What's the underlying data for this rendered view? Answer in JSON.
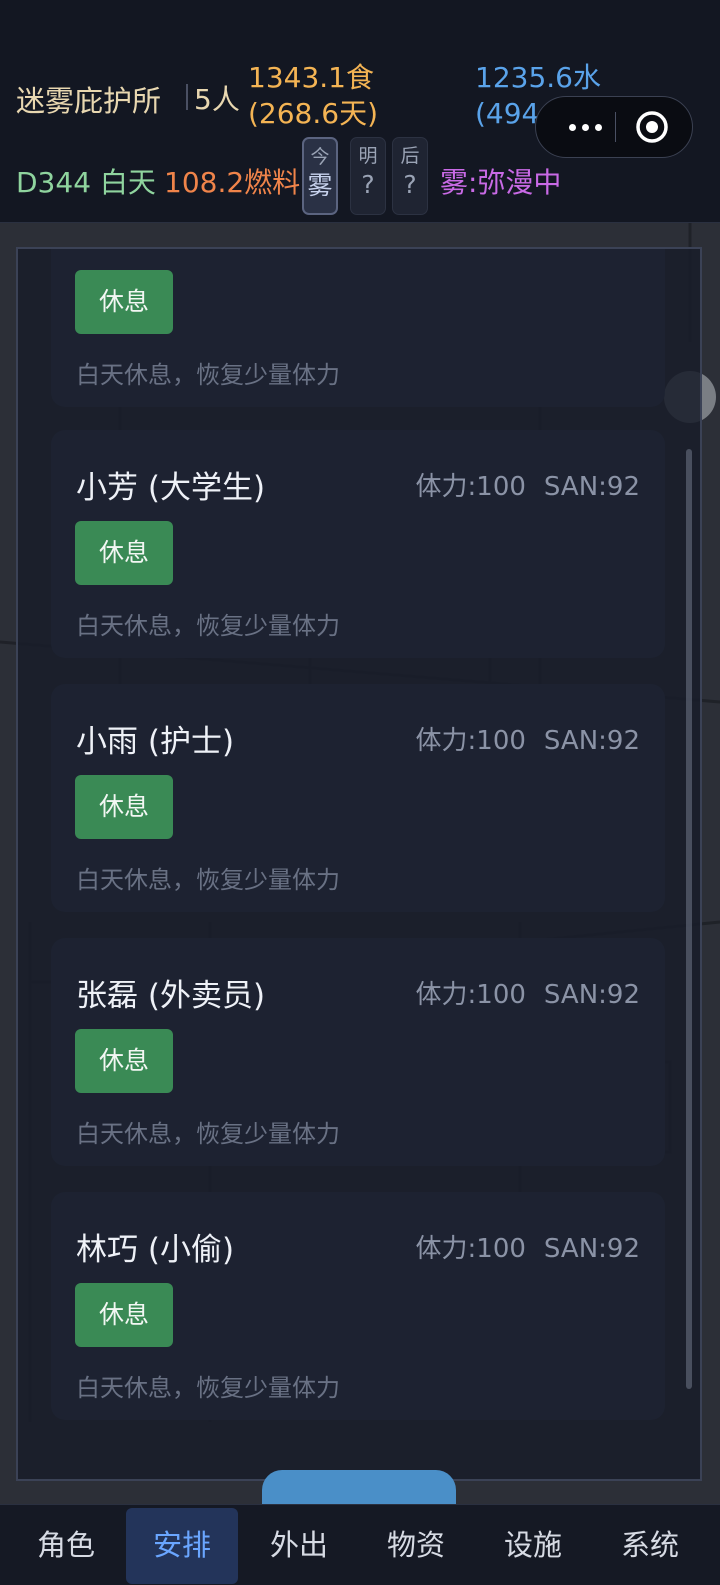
{
  "header": {
    "shelter_name": "迷雾庇护所",
    "people": "5人",
    "food": "1343.1食(268.6天)",
    "water": "1235.6水(494.2天)",
    "day": "D344 白天",
    "fuel": "108.2燃料",
    "forecast": [
      {
        "label": "今",
        "value": "雾"
      },
      {
        "label": "明",
        "value": "?"
      },
      {
        "label": "后",
        "value": "?"
      }
    ],
    "fog_status": "雾:弥漫中"
  },
  "capsule": {
    "more_icon": "more-dots-icon",
    "close_icon": "target-circle-icon"
  },
  "cards": [
    {
      "name": "",
      "stamina": "",
      "san": "",
      "action": "休息",
      "desc": "白天休息，恢复少量体力"
    },
    {
      "name": "小芳 (大学生)",
      "stamina": "体力:100",
      "san": "SAN:92",
      "action": "休息",
      "desc": "白天休息，恢复少量体力"
    },
    {
      "name": "小雨 (护士)",
      "stamina": "体力:100",
      "san": "SAN:92",
      "action": "休息",
      "desc": "白天休息，恢复少量体力"
    },
    {
      "name": "张磊 (外卖员)",
      "stamina": "体力:100",
      "san": "SAN:92",
      "action": "休息",
      "desc": "白天休息，恢复少量体力"
    },
    {
      "name": "林巧 (小偷)",
      "stamina": "体力:100",
      "san": "SAN:92",
      "action": "休息",
      "desc": "白天休息，恢复少量体力"
    }
  ],
  "tabs": [
    {
      "label": "角色"
    },
    {
      "label": "安排"
    },
    {
      "label": "外出"
    },
    {
      "label": "物资"
    },
    {
      "label": "设施"
    },
    {
      "label": "系统"
    }
  ],
  "active_tab": "安排",
  "colors": {
    "food": "#f4b454",
    "water": "#5aa3ea",
    "day": "#8fd49e",
    "fuel": "#f0844a",
    "fog": "#c96ae6",
    "action_button": "#3a8a55",
    "active_tab": "#6aa6ff"
  }
}
